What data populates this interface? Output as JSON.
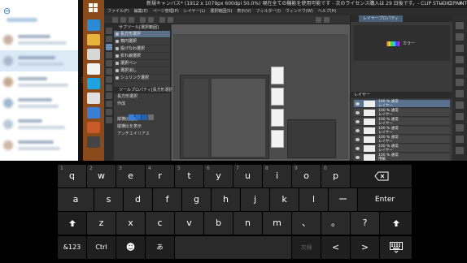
{
  "csp": {
    "title": "新規キャンバス* (1912 x 1079px 600dpi 50.0%)  現在全ての機能を使用可能です - 次のライセンス購入は 29 日後です。- CLIP STUDIO PAINT EX",
    "window_buttons": [
      "—",
      "☐",
      "✕"
    ],
    "menu": [
      "ファイル(F)",
      "編集(E)",
      "ページ管理(P)",
      "レイヤー(L)",
      "選択範囲(S)",
      "表示(V)",
      "フィルター(I)",
      "ウィンドウ(W)",
      "ヘルプ(H)"
    ],
    "subtool_header": "サブツール[選択範囲]",
    "subtool_items": [
      "長方形選択",
      "楕円選択",
      "投げなわ選択",
      "折れ線選択",
      "選択ペン",
      "選択消し",
      "シュリンク選択"
    ],
    "tool_property_header": "ツールプロパティ[長方形選択]",
    "tool_property_items": [
      "長方形選択",
      "作成",
      "縦横比指定",
      "縦横比を表示",
      "アンチエイリアス"
    ],
    "right_tabs": [
      "",
      "レイヤープロパティ"
    ],
    "color_label": "カラー",
    "layer_header": "レイヤー",
    "layers": [
      {
        "name": "100 % 通常",
        "sub": "レイヤー"
      },
      {
        "name": "100 % 通常",
        "sub": "レイヤー"
      },
      {
        "name": "100 % 通常",
        "sub": "レイヤー"
      },
      {
        "name": "100 % 通常",
        "sub": "レイヤー"
      },
      {
        "name": "100 % 通常",
        "sub": "レイヤー"
      },
      {
        "name": "100 % 通常",
        "sub": "レイヤー"
      },
      {
        "name": "100 % 通常",
        "sub": "用紙"
      }
    ]
  },
  "keyboard": {
    "row1": [
      {
        "label": "q",
        "alt": "1"
      },
      {
        "label": "w",
        "alt": "2"
      },
      {
        "label": "e",
        "alt": "3"
      },
      {
        "label": "r",
        "alt": "4"
      },
      {
        "label": "t",
        "alt": "5"
      },
      {
        "label": "y",
        "alt": "6"
      },
      {
        "label": "u",
        "alt": "7"
      },
      {
        "label": "i",
        "alt": "8"
      },
      {
        "label": "o",
        "alt": "9"
      },
      {
        "label": "p",
        "alt": "0"
      }
    ],
    "row2": [
      "a",
      "s",
      "d",
      "f",
      "g",
      "h",
      "j",
      "k",
      "l",
      "ー"
    ],
    "enter_label": "Enter",
    "row3": [
      "z",
      "x",
      "c",
      "v",
      "b",
      "n",
      "m",
      "、",
      "。",
      "?"
    ],
    "row4": {
      "numbers_label": "&123",
      "ctrl_label": "Ctrl",
      "emoji_label": "☻",
      "kana_label": "あ",
      "next_label": "次候",
      "left_label": "<",
      "right_label": ">"
    }
  },
  "icons": {
    "backspace": "backspace-icon",
    "shift": "shift-arrow-icon",
    "keyboard": "keyboard-icon",
    "back": "back-arrow-icon"
  },
  "colors": {
    "key_bg": "#2a2a2a",
    "taskbar": "#8a4a1c",
    "selection_blue": "#5a7290"
  }
}
